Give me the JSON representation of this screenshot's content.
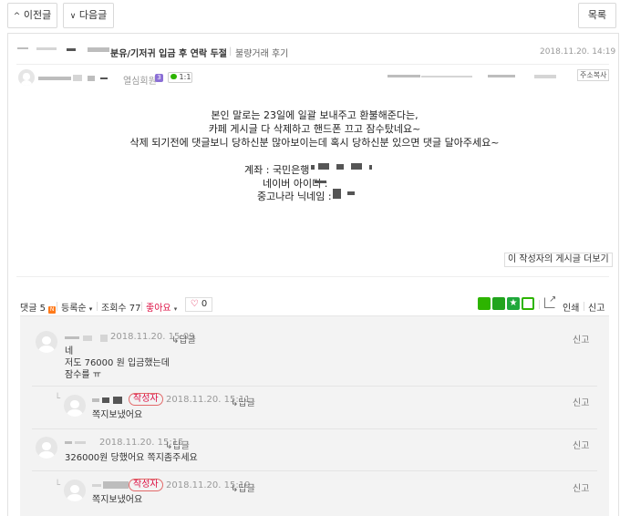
{
  "nav": {
    "prev_label": "이전글",
    "next_label": "다음글",
    "list_label": "목록"
  },
  "post": {
    "title": "분유/기저귀 입금 후 연락 두절",
    "category": "불량거래 후기",
    "date": "2018.11.20. 14:19",
    "author_grade": "열심회원",
    "grade_badge": "3",
    "chat_label": "1:1",
    "copy_address_label": "주소복사",
    "body_lines": [
      "본인 말로는 23일에 일괄 보내주고 환불해준다는,",
      "카페 게시글 다 삭제하고 핸드폰 끄고 잠수탔네요~",
      "삭제 되기전에 댓글보니 당하신분 많아보이는데 혹시 당하신분 있으면 댓글 달아주세요~"
    ],
    "account_label": "계좌 : 국민은행",
    "naver_label": "네이버 아이디 :",
    "joonggo_label": "중고나라 닉네임 :",
    "more_posts_label": "이 작성자의 게시글 더보기"
  },
  "toolbar": {
    "comments_label": "댓글",
    "comments_count": "5",
    "new_badge": "N",
    "sort_label": "등록순",
    "views_label": "조회수",
    "views_count": "77",
    "like_label": "좋아요",
    "heart_count": "0",
    "print_label": "인쇄",
    "report_label": "신고"
  },
  "comments": [
    {
      "date": "2018.11.20. 15:09",
      "reply_label": "답글",
      "report_label": "신고",
      "lines": [
        "네",
        "저도 76000 원 입금했는데",
        "잠수를 ㅠ"
      ]
    },
    {
      "writer_badge": "작성자",
      "date": "2018.11.20. 15:11",
      "reply_label": "답글",
      "report_label": "신고",
      "lines": [
        "쪽지보냈어요"
      ]
    },
    {
      "date": "2018.11.20. 15:15",
      "reply_label": "답글",
      "report_label": "신고",
      "lines": [
        "326000원 당했어요 쪽지좀주세요"
      ]
    },
    {
      "writer_badge": "작성자",
      "date": "2018.11.20. 15:19",
      "reply_label": "답글",
      "report_label": "신고",
      "lines": [
        "쪽지보냈어요"
      ]
    }
  ],
  "colors": {
    "accent_red": "#d14",
    "naver_green": "#2db400",
    "border": "#e2e2e2"
  }
}
